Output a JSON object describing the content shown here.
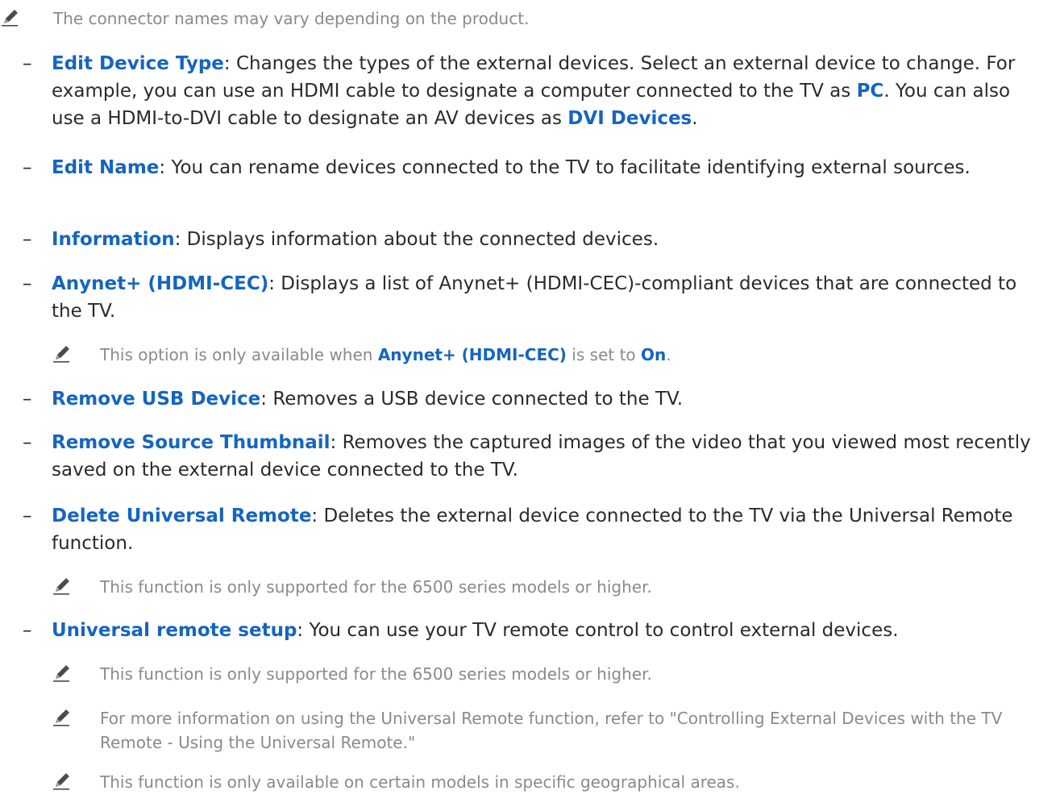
{
  "top_note": "The connector names may vary depending on the product.",
  "dash": "–",
  "items": {
    "edit_device_type": {
      "term": "Edit Device Type",
      "t1": ": Changes the types of the external devices. Select an external device to change. For example, you can use an HDMI cable to designate a computer connected to the TV as ",
      "pc": "PC",
      "t2": ". You can also use a HDMI-to-DVI cable to designate an AV devices as ",
      "dvi": "DVI Devices",
      "t3": "."
    },
    "edit_name": {
      "term": "Edit Name",
      "text": ": You can rename devices connected to the TV to facilitate identifying external sources."
    },
    "information": {
      "term": "Information",
      "text": ": Displays information about the connected devices."
    },
    "anynet": {
      "term": "Anynet+ (HDMI-CEC)",
      "text": ": Displays a list of Anynet+ (HDMI-CEC)-compliant devices that are connected to the TV.",
      "note_t1": "This option is only available when ",
      "note_term": "Anynet+ (HDMI-CEC)",
      "note_t2": " is set to ",
      "note_on": "On",
      "note_t3": "."
    },
    "remove_usb": {
      "term": "Remove USB Device",
      "text": ": Removes a USB device connected to the TV."
    },
    "remove_thumb": {
      "term": "Remove Source Thumbnail",
      "text": ": Removes the captured images of the video that you viewed most recently saved on the external device connected to the TV."
    },
    "delete_remote": {
      "term": "Delete Universal Remote",
      "text": ": Deletes the external device connected to the TV via the Universal Remote function.",
      "note": "This function is only supported for the 6500 series models or higher."
    },
    "remote_setup": {
      "term": "Universal remote setup",
      "text": ": You can use your TV remote control to control external devices.",
      "note1": "This function is only supported for the 6500 series models or higher.",
      "note2": "For more information on using the Universal Remote function, refer to \"Controlling External Devices with the TV Remote - Using the Universal Remote.\"",
      "note3": "This function is only available on certain models in specific geographical areas."
    }
  }
}
